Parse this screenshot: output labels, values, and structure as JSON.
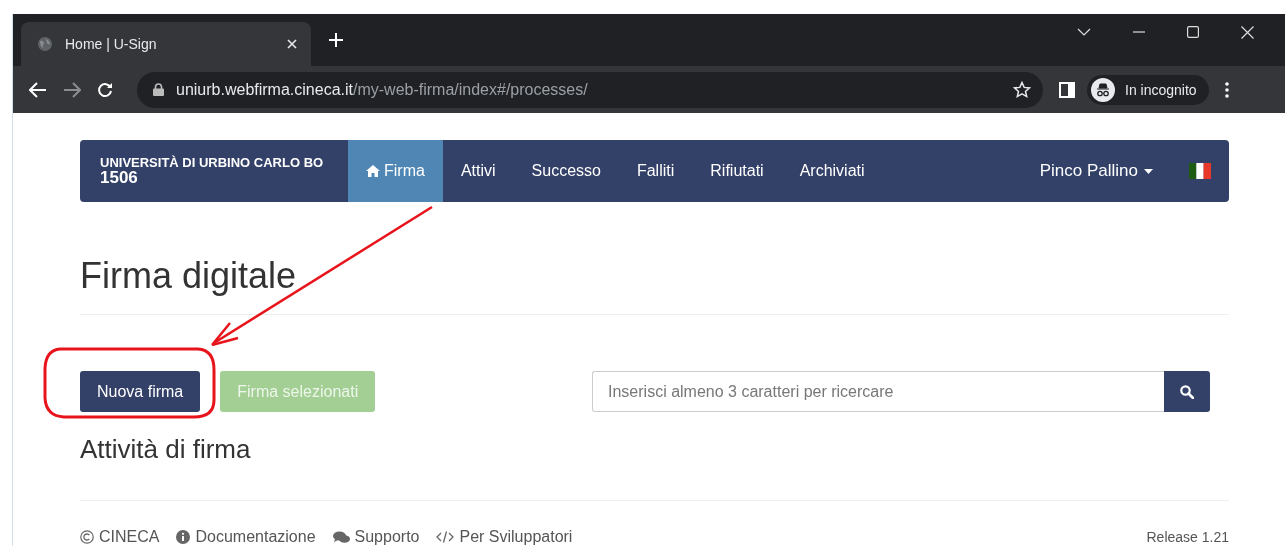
{
  "browser": {
    "tabs": [
      {
        "title": "Home | U-Sign",
        "selected": true
      }
    ],
    "address": {
      "host": "uniurb.webfirma.cineca.it",
      "path": "/my-web-firma/index#/processes/"
    },
    "profile": "In incognito"
  },
  "navbar": {
    "brand": {
      "name": "UNIVERSITÀ DI URBINO CARLO BO",
      "year": "1506"
    },
    "items": [
      {
        "label": "Firma",
        "kind": "home",
        "selected": true
      },
      {
        "label": "Attivi",
        "selected": false
      },
      {
        "label": "Successo",
        "selected": false
      },
      {
        "label": "Falliti",
        "selected": false
      },
      {
        "label": "Rifiutati",
        "selected": false
      },
      {
        "label": "Archiviati",
        "selected": false
      }
    ],
    "user": "Pinco Pallino"
  },
  "title": "Firma digitale",
  "actions": [
    {
      "label": "Nuova firma",
      "disabled": false
    },
    {
      "label": "Firma selezionati",
      "disabled": true
    }
  ],
  "search": {
    "placeholder": "Inserisci almeno 3 caratteri per ricercare"
  },
  "section_title": "Attività di firma",
  "footer": {
    "links": [
      {
        "label": "CINECA",
        "kind": "copyright"
      },
      {
        "label": "Documentazione",
        "kind": "info"
      },
      {
        "label": "Supporto",
        "kind": "chat"
      },
      {
        "label": "Per Sviluppatori",
        "kind": "code"
      }
    ],
    "release": "Release 1.21"
  }
}
